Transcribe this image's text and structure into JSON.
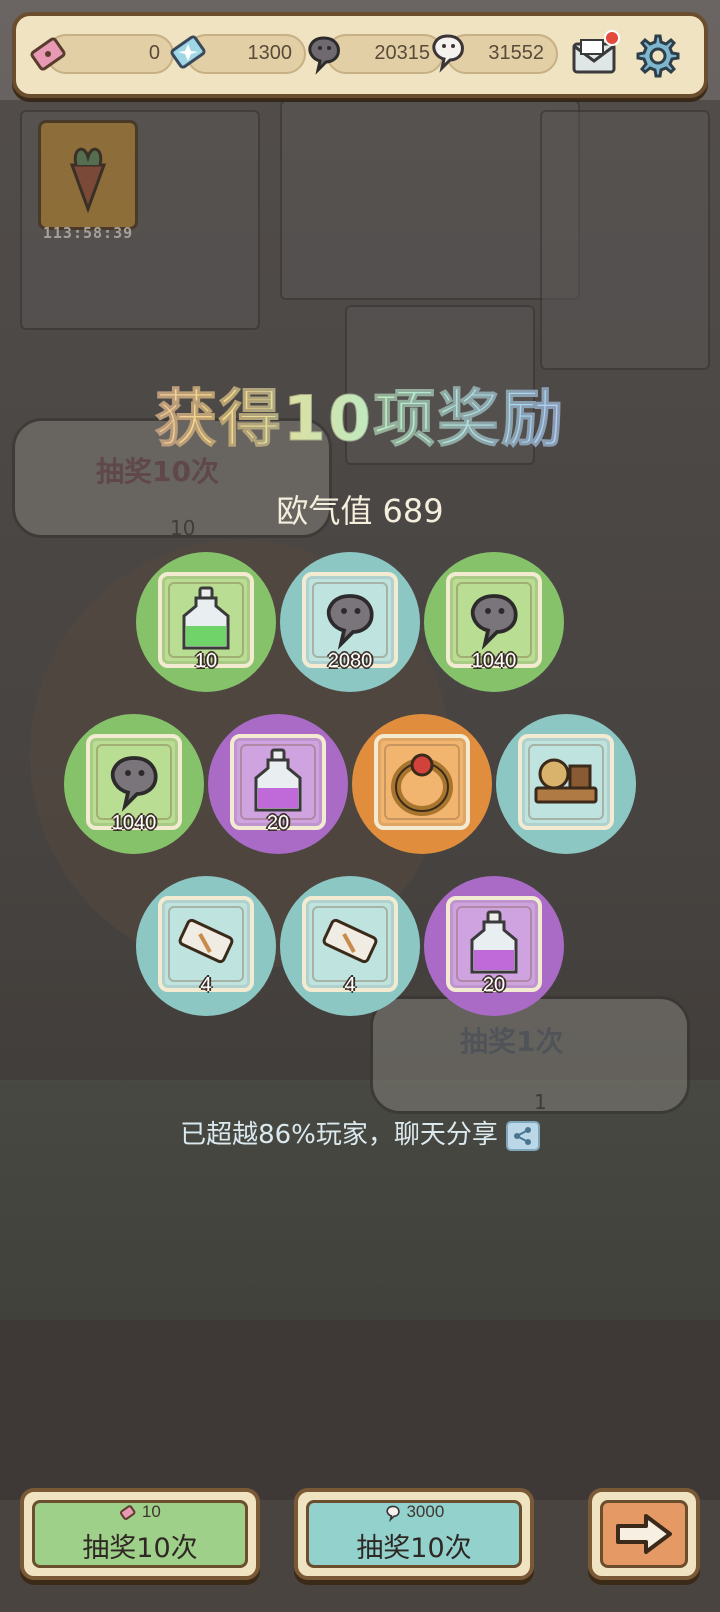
{
  "resources": {
    "ticket": "0",
    "crystal": "1300",
    "dark_ghost": "20315",
    "light_ghost": "31552"
  },
  "event": {
    "timer": "113:58:39"
  },
  "background_panels": {
    "left_label": "抽奖10次",
    "left_cost": "10",
    "right_label": "抽奖1次",
    "right_cost": "1"
  },
  "result": {
    "title": "获得10项奖励",
    "luck_label": "欧气值 689",
    "share_text": "已超越86%玩家，聊天分享"
  },
  "rewards": [
    {
      "color": "green",
      "item": "green-potion-icon",
      "qty": "10"
    },
    {
      "color": "teal",
      "item": "ghost-soul-icon",
      "qty": "2080"
    },
    {
      "color": "green",
      "item": "ghost-soul-icon",
      "qty": "1040"
    },
    {
      "color": "green",
      "item": "ghost-soul-icon",
      "qty": "1040"
    },
    {
      "color": "purple",
      "item": "purple-potion-icon",
      "qty": "20"
    },
    {
      "color": "orange",
      "item": "gold-ring-icon",
      "qty": ""
    },
    {
      "color": "teal",
      "item": "machine-icon",
      "qty": ""
    },
    {
      "color": "teal",
      "item": "scroll-icon",
      "qty": "4"
    },
    {
      "color": "teal",
      "item": "scroll-icon",
      "qty": "4"
    },
    {
      "color": "purple",
      "item": "purple-potion-icon",
      "qty": "20"
    }
  ],
  "buttons": {
    "draw_ticket": {
      "cost": "10",
      "label": "抽奖10次",
      "color": "#9fd08a"
    },
    "draw_ghost": {
      "cost": "3000",
      "label": "抽奖10次",
      "color": "#92d1cc"
    },
    "next": {
      "color": "#e59a66"
    }
  }
}
